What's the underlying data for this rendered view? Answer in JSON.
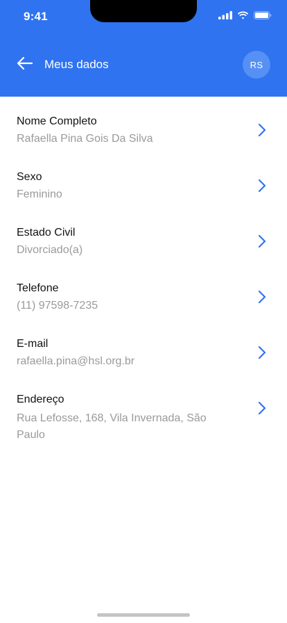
{
  "status_bar": {
    "time": "9:41"
  },
  "header": {
    "title": "Meus dados",
    "avatar_initials": "RS",
    "background_color": "#2f73f0"
  },
  "icons": {
    "back": "arrow-left-icon",
    "chevron": "chevron-right-icon",
    "signal": "signal-icon",
    "wifi": "wifi-icon",
    "battery": "battery-icon"
  },
  "fields": [
    {
      "label": "Nome Completo",
      "value": "Rafaella Pina Gois Da Silva"
    },
    {
      "label": "Sexo",
      "value": "Feminino"
    },
    {
      "label": "Estado Civil",
      "value": "Divorciado(a)"
    },
    {
      "label": "Telefone",
      "value": "(11) 97598-7235"
    },
    {
      "label": "E-mail",
      "value": "rafaella.pina@hsl.org.br"
    },
    {
      "label": "Endereço",
      "value": "Rua Lefosse, 168, Vila Invernada, São Paulo"
    }
  ],
  "colors": {
    "accent": "#2f73f0",
    "label": "#111111",
    "value": "#9a9a9a"
  }
}
